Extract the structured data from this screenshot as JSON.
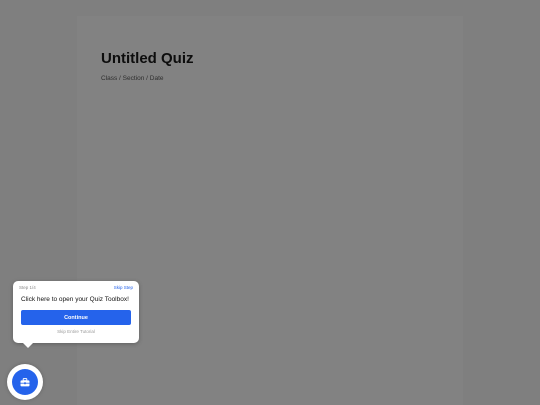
{
  "document": {
    "title": "Untitled Quiz",
    "subtitle": "Class / Section / Date"
  },
  "tutorial": {
    "step_label": "Step 1/4",
    "skip_step_label": "Skip Step",
    "message": "Click here to open your Quiz Toolbox!",
    "continue_label": "Continue",
    "skip_tutorial_label": "Skip Entire Tutorial"
  },
  "toolbox_button": {
    "icon": "toolbox-icon"
  },
  "colors": {
    "accent": "#2563eb",
    "overlay": "#7f7f7f"
  }
}
